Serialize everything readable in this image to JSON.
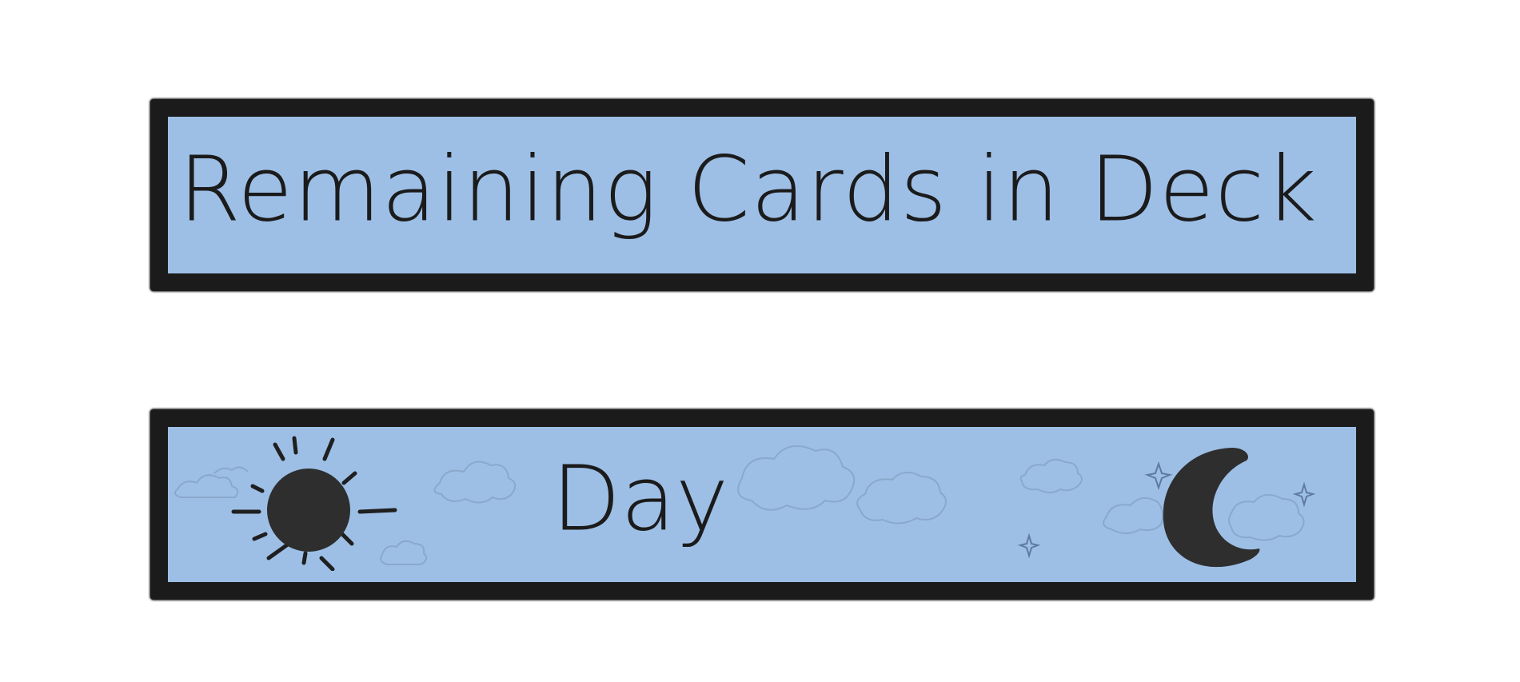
{
  "deck_panel": {
    "label": "Remaining Cards in Deck"
  },
  "day_night_panel": {
    "label": "Day",
    "icons": [
      "sun-icon",
      "moon-icon",
      "cloud-icon",
      "star-icon"
    ]
  },
  "colors": {
    "panel_fill": "#9dbfe6",
    "border": "#1b1b1b",
    "icon_fill": "#2e2e2e",
    "cloud_stroke": "#86a3c6",
    "background": "#ffffff"
  }
}
